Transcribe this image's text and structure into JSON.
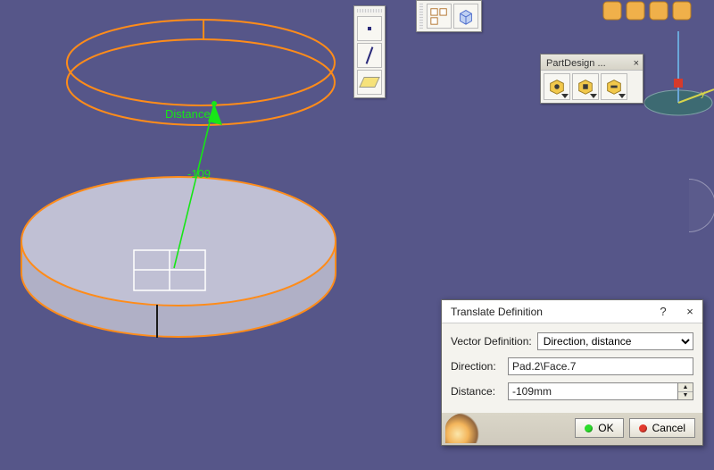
{
  "viewport": {
    "distance_label": "Distance",
    "distance_value": "-109"
  },
  "toolbars": {
    "sketch": {
      "line_tool": "line-tool",
      "quad_tool": "plane-tool"
    },
    "view": {
      "layout_tool": "layout-tool",
      "cube_tool": "orientation-cube"
    }
  },
  "partdesign": {
    "title": "PartDesign ...",
    "tools": [
      "measure-between",
      "measure-item",
      "measure-thickness"
    ]
  },
  "dialog": {
    "title": "Translate Definition",
    "vector_def_label": "Vector Definition:",
    "vector_def_value": "Direction, distance",
    "direction_label": "Direction:",
    "direction_value": "Pad.2\\Face.7",
    "distance_label": "Distance:",
    "distance_value": "-109mm",
    "ok": "OK",
    "cancel": "Cancel"
  }
}
